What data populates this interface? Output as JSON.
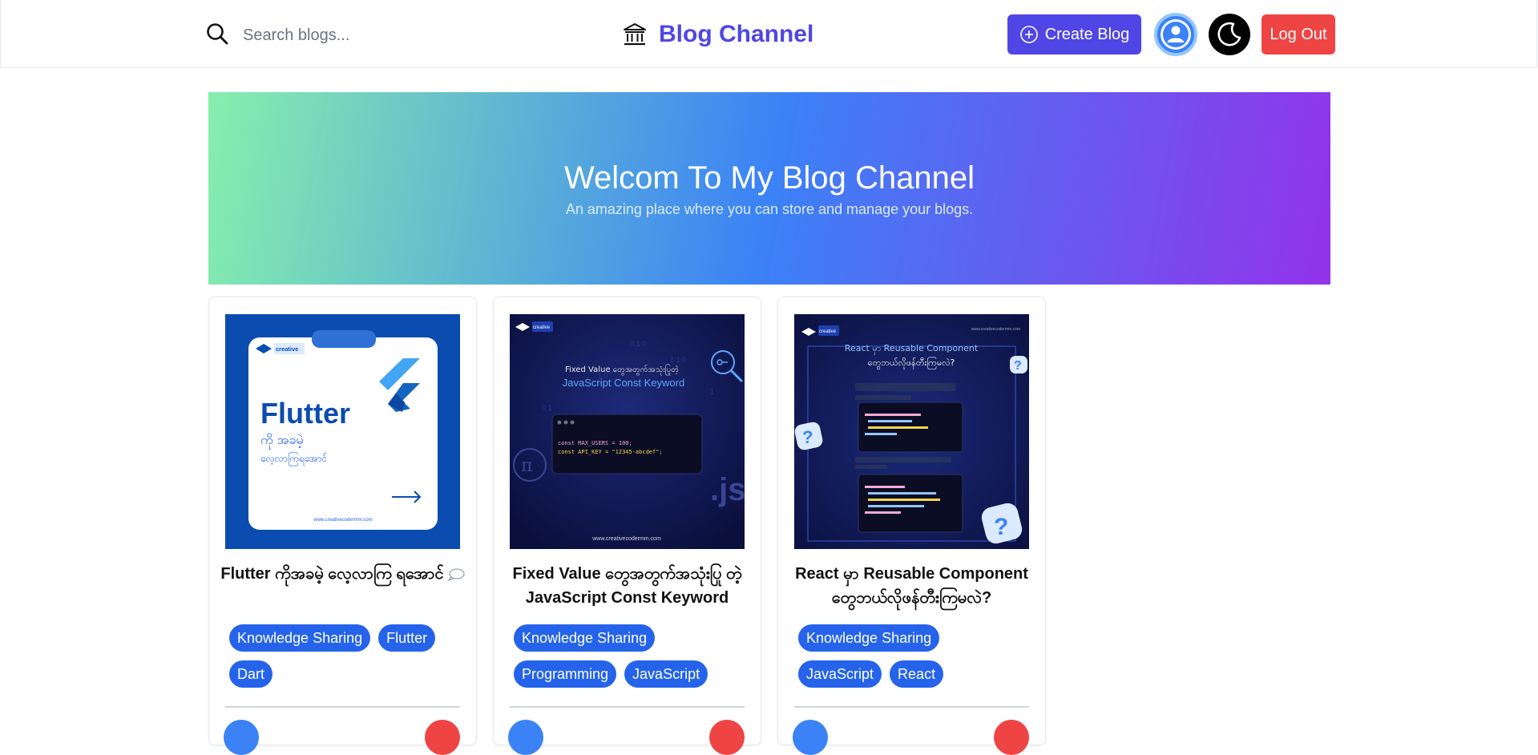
{
  "header": {
    "search": {
      "placeholder": "Search blogs...",
      "value": ""
    },
    "brand_title": "Blog Channel",
    "create_label": "Create Blog",
    "logout_label": "Log Out"
  },
  "hero": {
    "title": "Welcom To My Blog Channel",
    "subtitle": "An amazing place where you can store and manage your blogs."
  },
  "cards": [
    {
      "title": "Flutter ကိုအခမဲ့ လေ့လာကြ ရအောင်",
      "tags": [
        "Knowledge Sharing",
        "Flutter",
        "Dart"
      ],
      "thumb": {
        "brand": "creative",
        "heading": "Flutter",
        "line1": "ကို အခမဲ့",
        "line2": "လေ့လာကြရအောင်",
        "url": "www.creativecodermm.com"
      }
    },
    {
      "title": "Fixed Value တွေအတွက်အသုံးပြု တဲ့ JavaScript Const Keyword",
      "tags": [
        "Knowledge Sharing",
        "Programming",
        "JavaScript"
      ],
      "thumb": {
        "brand": "creative",
        "line1": "Fixed Value တွေအတွက်အသုံးပြုတဲ့",
        "line2": "JavaScript Const Keyword",
        "code1": "const MAX_USERS = 100;",
        "code2": "const API_KEY = \"12345-abcdef\";",
        "url": "www.creativecodermm.com"
      }
    },
    {
      "title": "React မှာ Reusable Component တွေဘယ်လိုဖန်တီးကြမလဲ?",
      "tags": [
        "Knowledge Sharing",
        "JavaScript",
        "React"
      ],
      "thumb": {
        "brand": "creative",
        "site": "www.creativecodermm.com",
        "line1": "React မှာ Reusable Component",
        "line2": "တွေဘယ်လိုဖန်တီးကြမလဲ?"
      }
    }
  ],
  "colors": {
    "brand": "#4f46e5",
    "tag": "#2563eb",
    "danger": "#ef4444",
    "hero_start": "#86efac",
    "hero_mid": "#3b82f6",
    "hero_end": "#9333ea"
  },
  "icons": {
    "search": "search-icon",
    "brand": "bank-icon",
    "create": "plus-circle-icon",
    "avatar": "user-icon",
    "theme": "moon-icon",
    "comment": "chat-bubble-icon"
  }
}
